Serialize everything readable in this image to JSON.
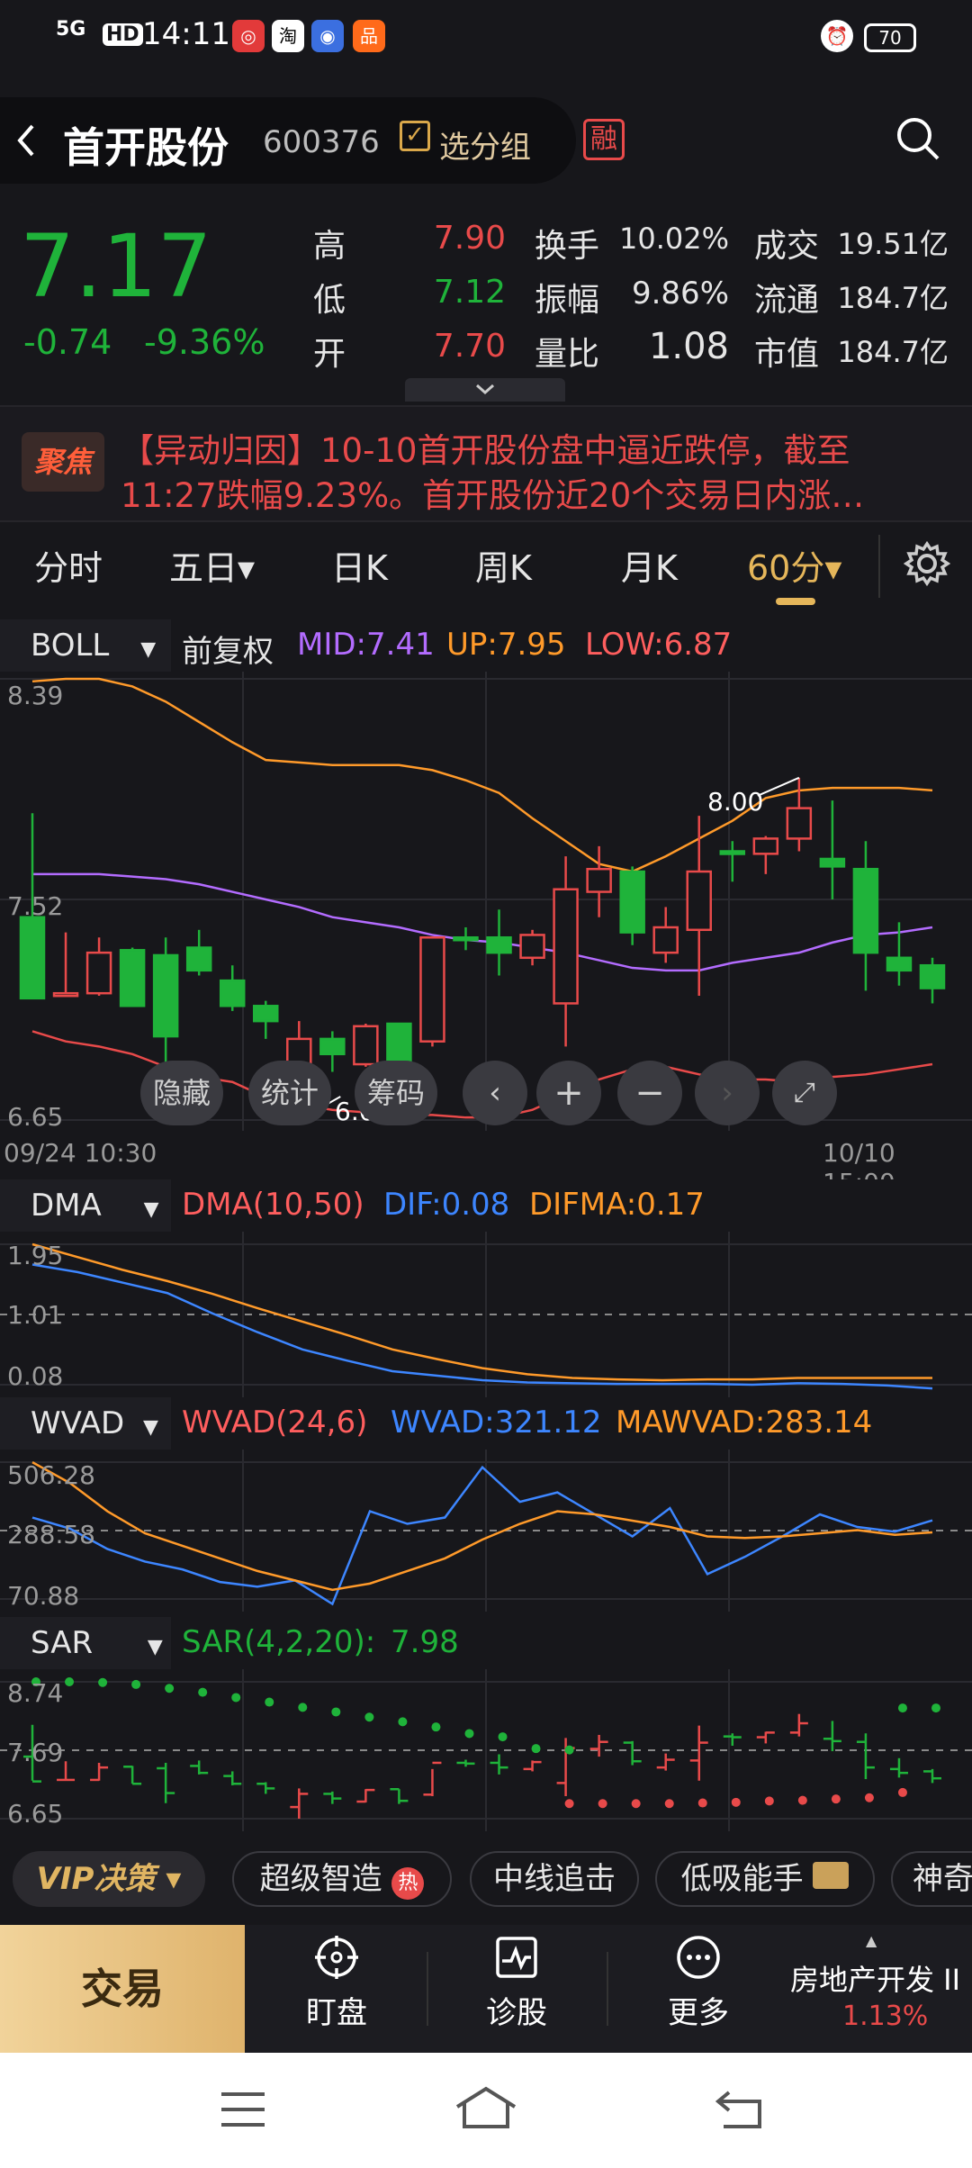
{
  "status_bar": {
    "network": "5G",
    "hd": "HD",
    "time": "14:11",
    "battery": "70"
  },
  "header": {
    "back_icon": "chevron-left-icon",
    "stock_name": "首开股份",
    "stock_code": "600376",
    "group_label": "选分组",
    "margin_badge": "融",
    "search_icon": "search-icon"
  },
  "quote": {
    "price": "7.17",
    "change": "-0.74",
    "change_pct": "-9.36%",
    "high_label": "高",
    "high": "7.90",
    "low_label": "低",
    "low": "7.12",
    "open_label": "开",
    "open": "7.70",
    "turnover_label": "换手",
    "turnover": "10.02%",
    "amplitude_label": "振幅",
    "amplitude": "9.86%",
    "vol_ratio_label": "量比",
    "vol_ratio": "1.08",
    "volume_label": "成交",
    "volume": "19.51亿",
    "float_label": "流通",
    "float_cap": "184.7亿",
    "mktcap_label": "市值",
    "mktcap": "184.7亿"
  },
  "news": {
    "badge": "聚焦",
    "line1": "【异动归因】10-10首开股份盘中逼近跌停，截至",
    "line2": "11:27跌幅9.23%。首开股份近20个交易日内涨…"
  },
  "tabs": [
    "分时",
    "五日▾",
    "日K",
    "周K",
    "月K",
    "60分▾"
  ],
  "boll": {
    "name": "BOLL",
    "adj": "前复权",
    "mid": "MID:7.41",
    "up": "UP:7.95",
    "low": "LOW:6.87",
    "y_top": "8.39",
    "y_mid": "7.52",
    "y_bot": "6.65",
    "hi_mark": "8.00",
    "lo_mark": "6.65",
    "x_start": "09/24 10:30",
    "x_end": "10/10 15:00"
  },
  "chart_controls": {
    "hide": "隐藏",
    "stats": "统计",
    "chips": "筹码"
  },
  "dma": {
    "name": "DMA",
    "param": "DMA(10,50)",
    "dif": "DIF:0.08",
    "difma": "DIFMA:0.17",
    "y_top": "1.95",
    "y_mid": "1.01",
    "y_bot": "0.08"
  },
  "wvad": {
    "name": "WVAD",
    "param": "WVAD(24,6)",
    "wvad": "WVAD:321.12",
    "mawvad": "MAWVAD:283.14",
    "y_top": "506.28",
    "y_mid": "288.58",
    "y_bot": "70.88"
  },
  "sar": {
    "name": "SAR",
    "param": "SAR(4,2,20):",
    "value": "7.98",
    "y_top": "8.74",
    "y_mid": "7.69",
    "y_bot": "6.65"
  },
  "pills": {
    "vip": "VIP决策",
    "p1": "超级智造",
    "hot": "热",
    "p2": "中线追击",
    "p3": "低吸能手",
    "p4": "神奇"
  },
  "bottom_nav": {
    "trade": "交易",
    "watch": "盯盘",
    "diagnose": "诊股",
    "more": "更多",
    "sector_name": "房地产开发 II",
    "sector_pct": "1.13%"
  },
  "chart_data": [
    {
      "type": "candlestick",
      "title": "BOLL",
      "ylim": [
        6.65,
        8.39
      ],
      "x_start": "09/24 10:30",
      "x_end": "10/10 15:00",
      "candles": [
        {
          "o": 7.45,
          "h": 7.86,
          "l": 7.14,
          "c": 7.13
        },
        {
          "o": 7.15,
          "h": 7.39,
          "l": 7.14,
          "c": 7.15
        },
        {
          "o": 7.15,
          "h": 7.37,
          "l": 7.14,
          "c": 7.31
        },
        {
          "o": 7.32,
          "h": 7.33,
          "l": 7.1,
          "c": 7.1
        },
        {
          "o": 7.3,
          "h": 7.37,
          "l": 6.85,
          "c": 6.98
        },
        {
          "o": 7.33,
          "h": 7.4,
          "l": 7.22,
          "c": 7.24
        },
        {
          "o": 7.2,
          "h": 7.26,
          "l": 7.08,
          "c": 7.1
        },
        {
          "o": 7.1,
          "h": 7.12,
          "l": 6.97,
          "c": 7.04
        },
        {
          "o": 6.8,
          "h": 7.04,
          "l": 6.65,
          "c": 6.97
        },
        {
          "o": 6.97,
          "h": 7.0,
          "l": 6.84,
          "c": 6.91
        },
        {
          "o": 6.87,
          "h": 7.03,
          "l": 6.86,
          "c": 7.02
        },
        {
          "o": 7.03,
          "h": 7.03,
          "l": 6.84,
          "c": 6.88
        },
        {
          "o": 6.96,
          "h": 7.29,
          "l": 6.94,
          "c": 7.37
        },
        {
          "o": 7.37,
          "h": 7.41,
          "l": 7.32,
          "c": 7.36
        },
        {
          "o": 7.37,
          "h": 7.48,
          "l": 7.22,
          "c": 7.31
        },
        {
          "o": 7.29,
          "h": 7.4,
          "l": 7.26,
          "c": 7.38
        },
        {
          "o": 7.11,
          "h": 7.69,
          "l": 6.94,
          "c": 7.56
        },
        {
          "o": 7.55,
          "h": 7.73,
          "l": 7.45,
          "c": 7.64
        },
        {
          "o": 7.63,
          "h": 7.65,
          "l": 7.34,
          "c": 7.39
        },
        {
          "o": 7.31,
          "h": 7.49,
          "l": 7.27,
          "c": 7.41
        },
        {
          "o": 7.4,
          "h": 7.85,
          "l": 7.14,
          "c": 7.63
        },
        {
          "o": 7.71,
          "h": 7.75,
          "l": 7.59,
          "c": 7.7
        },
        {
          "o": 7.7,
          "h": 7.77,
          "l": 7.62,
          "c": 7.76
        },
        {
          "o": 7.76,
          "h": 8.0,
          "l": 7.71,
          "c": 7.88
        },
        {
          "o": 7.68,
          "h": 7.91,
          "l": 7.52,
          "c": 7.65
        },
        {
          "o": 7.64,
          "h": 7.75,
          "l": 7.16,
          "c": 7.31
        },
        {
          "o": 7.29,
          "h": 7.43,
          "l": 7.18,
          "c": 7.24
        },
        {
          "o": 7.26,
          "h": 7.29,
          "l": 7.11,
          "c": 7.17
        }
      ],
      "mid": [
        7.62,
        7.62,
        7.62,
        7.61,
        7.6,
        7.58,
        7.55,
        7.52,
        7.49,
        7.45,
        7.43,
        7.41,
        7.38,
        7.36,
        7.35,
        7.33,
        7.31,
        7.28,
        7.25,
        7.24,
        7.24,
        7.27,
        7.29,
        7.31,
        7.35,
        7.38,
        7.39,
        7.41
      ],
      "up": [
        8.38,
        8.39,
        8.39,
        8.36,
        8.3,
        8.22,
        8.14,
        8.07,
        8.06,
        8.05,
        8.05,
        8.05,
        8.03,
        7.99,
        7.94,
        7.84,
        7.75,
        7.66,
        7.63,
        7.69,
        7.76,
        7.83,
        7.92,
        7.95,
        7.96,
        7.96,
        7.96,
        7.95
      ],
      "low": [
        7.0,
        6.96,
        6.94,
        6.91,
        6.86,
        6.82,
        6.8,
        6.74,
        6.71,
        6.69,
        6.68,
        6.67,
        6.67,
        6.66,
        6.66,
        6.69,
        6.75,
        6.81,
        6.85,
        6.86,
        6.83,
        6.81,
        6.81,
        6.8,
        6.82,
        6.83,
        6.85,
        6.87
      ]
    },
    {
      "type": "line",
      "title": "DMA",
      "ylim": [
        0.08,
        1.95
      ],
      "series": [
        {
          "name": "DIF",
          "color": "#3d86ff",
          "values": [
            1.68,
            1.58,
            1.44,
            1.3,
            1.03,
            0.78,
            0.55,
            0.4,
            0.26,
            0.2,
            0.14,
            0.11,
            0.1,
            0.09,
            0.09,
            0.09,
            0.08,
            0.1,
            0.09,
            0.07,
            0.03
          ]
        },
        {
          "name": "DIFMA",
          "color": "#ff9a2a",
          "values": [
            1.95,
            1.78,
            1.61,
            1.46,
            1.29,
            1.1,
            0.92,
            0.74,
            0.55,
            0.42,
            0.3,
            0.22,
            0.17,
            0.15,
            0.14,
            0.15,
            0.15,
            0.17,
            0.17,
            0.17,
            0.17
          ]
        }
      ]
    },
    {
      "type": "line",
      "title": "WVAD",
      "ylim": [
        70.88,
        506.28
      ],
      "series": [
        {
          "name": "WVAD",
          "color": "#3d86ff",
          "values": [
            330,
            295,
            230,
            190,
            165,
            125,
            110,
            130,
            55,
            350,
            310,
            330,
            490,
            380,
            410,
            340,
            270,
            360,
            150,
            205,
            270,
            340,
            300,
            285,
            321
          ]
        },
        {
          "name": "MAWVAD",
          "color": "#ff9a2a",
          "values": [
            506,
            440,
            350,
            280,
            240,
            200,
            160,
            130,
            100,
            120,
            160,
            200,
            260,
            310,
            350,
            340,
            320,
            300,
            270,
            265,
            270,
            280,
            290,
            275,
            283
          ]
        }
      ]
    },
    {
      "type": "scatter",
      "title": "SAR",
      "ylim": [
        6.65,
        8.74
      ],
      "red_dots": [
        6.88,
        6.88,
        6.88,
        6.88,
        6.89,
        6.9,
        6.92,
        6.93,
        6.95,
        6.97,
        7.05
      ],
      "green_dots": [
        8.74,
        8.74,
        8.73,
        8.7,
        8.64,
        8.58,
        8.5,
        8.43,
        8.35,
        8.28,
        8.2,
        8.13,
        8.05,
        7.95,
        7.9,
        7.72,
        7.7,
        8.34,
        8.34
      ]
    }
  ]
}
